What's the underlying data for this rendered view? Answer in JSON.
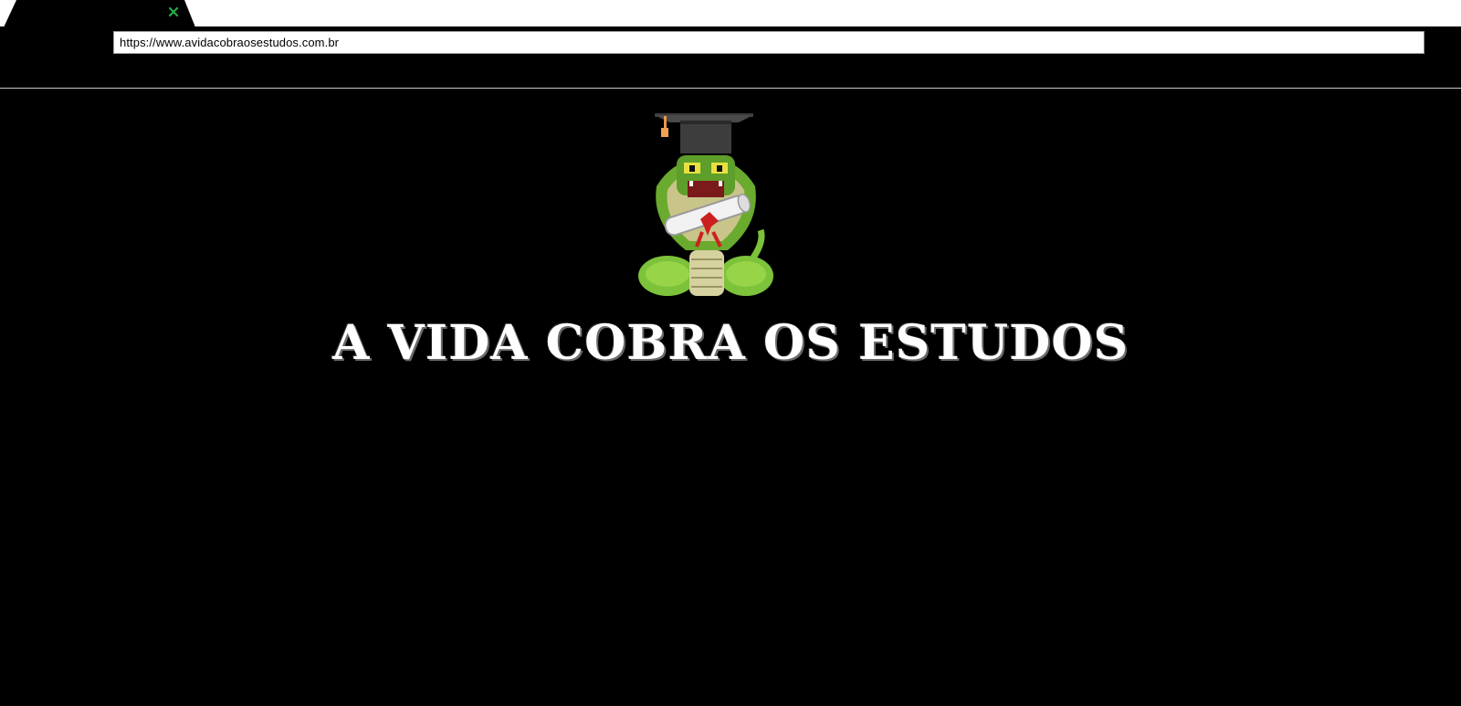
{
  "browser": {
    "tab": {
      "close_icon": "close-icon",
      "accent_color": "#22aa44"
    },
    "address_bar": {
      "url": "https://www.avidacobraosestudos.com.br"
    }
  },
  "page": {
    "logo": {
      "icon": "cobra-graduate-logo-icon"
    },
    "title": "A VIDA COBRA OS ESTUDOS"
  }
}
